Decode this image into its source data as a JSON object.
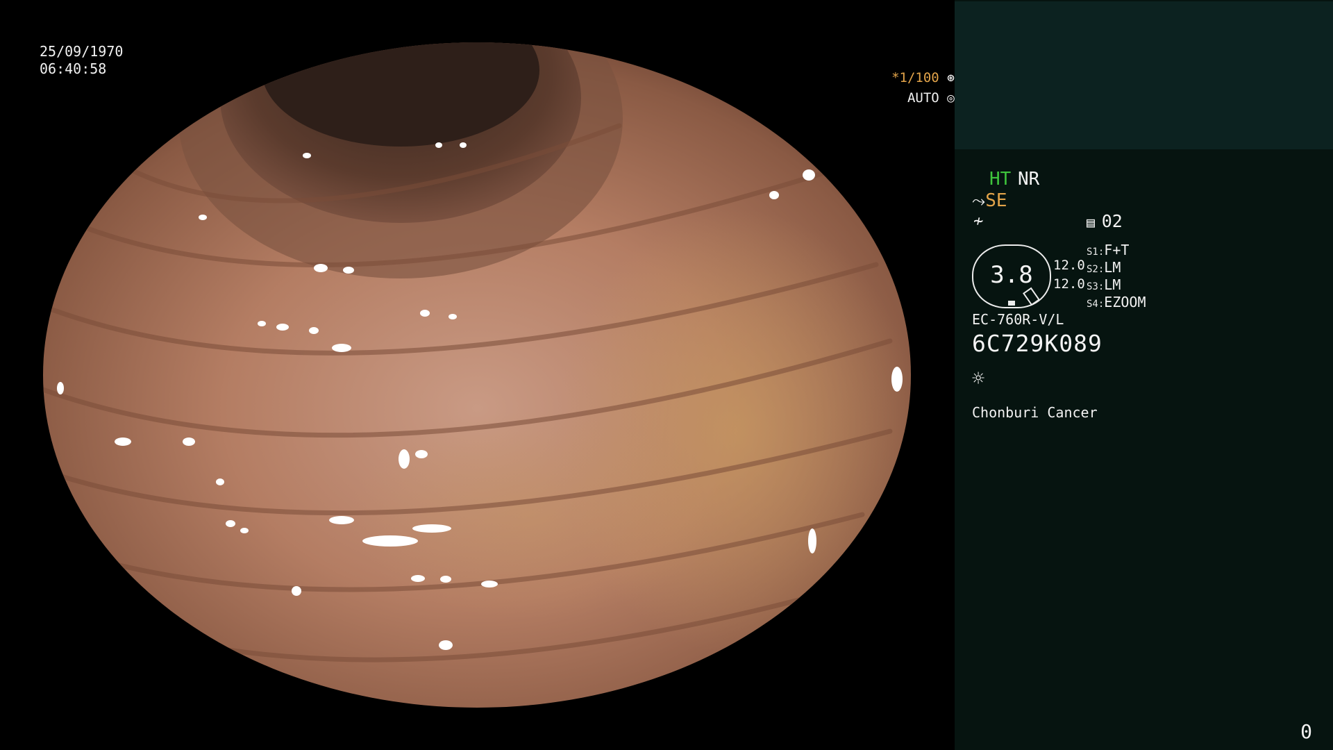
{
  "overlay": {
    "date": "25/09/1970",
    "time": "06:40:58",
    "shutter": "*1/100",
    "shutter_icon": "shutter-icon",
    "iris": "AUTO",
    "iris_icon": "iris-icon"
  },
  "panel": {
    "ht": "HT",
    "nr": "NR",
    "se": "SE",
    "se_icon": "structure-enhance-icon",
    "af_icon": "color-enhance-icon",
    "slot_icon": "memory-icon",
    "slot_value": "02",
    "ring_value": "3.8",
    "value_a": "12.0",
    "value_b": "12.0",
    "switches": [
      {
        "key": "S1:",
        "value": "F+T"
      },
      {
        "key": "S2:",
        "value": "LM"
      },
      {
        "key": "S3:",
        "value": "LM"
      },
      {
        "key": "S4:",
        "value": "EZOOM"
      }
    ],
    "scope_model": "EC-760R-V/L",
    "serial": "6C729K089",
    "light_icon": "light-source-icon",
    "institution": "Chonburi Cancer"
  },
  "footer": {
    "counter": "0"
  },
  "colors": {
    "ht": "#3ec43c",
    "se": "#e3a44a",
    "panel_bg": "#061410",
    "panel_top": "#0c2220"
  }
}
